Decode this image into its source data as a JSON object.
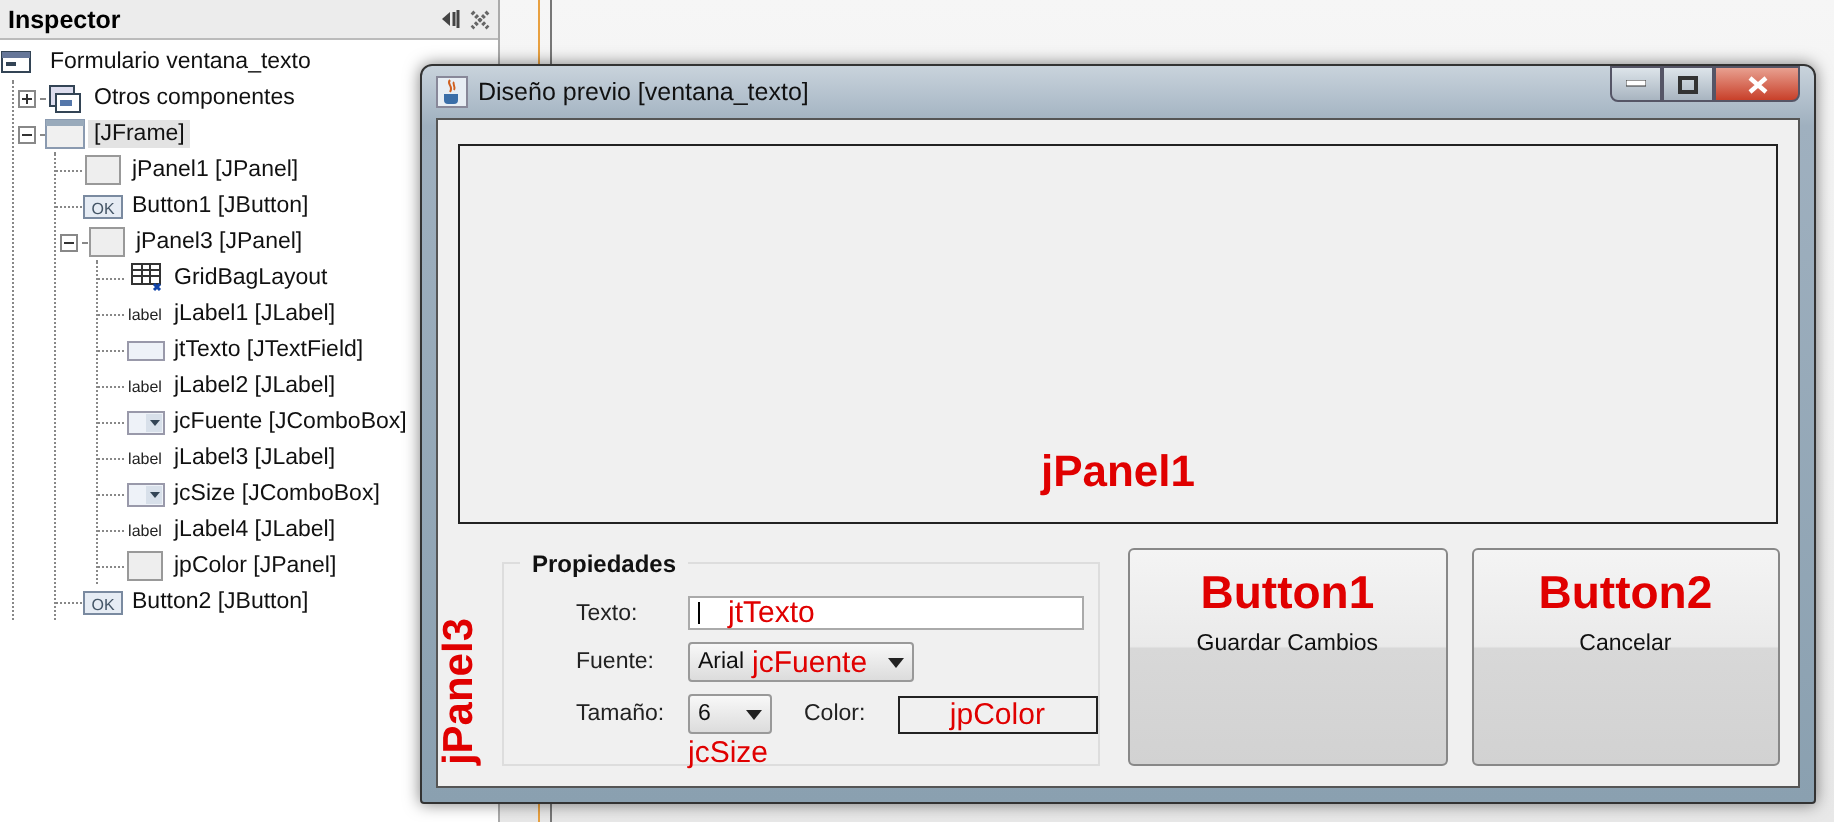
{
  "inspector": {
    "title": "Inspector",
    "tree": [
      {
        "label": "Formulario ventana_texto",
        "kind": "form",
        "selected": false,
        "children": [
          {
            "label": "Otros componentes",
            "kind": "components",
            "selected": false,
            "expanded": false
          },
          {
            "label": "[JFrame]",
            "kind": "frame",
            "selected": true,
            "expanded": true,
            "children": [
              {
                "label": "jPanel1 [JPanel]",
                "kind": "panel",
                "selected": false
              },
              {
                "label": "Button1 [JButton]",
                "kind": "button",
                "icon_text": "OK",
                "selected": false
              },
              {
                "label": "jPanel3 [JPanel]",
                "kind": "panel",
                "selected": false,
                "expanded": true,
                "children": [
                  {
                    "label": "GridBagLayout",
                    "kind": "layout",
                    "selected": false
                  },
                  {
                    "label": "jLabel1 [JLabel]",
                    "kind": "label",
                    "icon_text": "label",
                    "selected": false
                  },
                  {
                    "label": "jtTexto [JTextField]",
                    "kind": "textfield",
                    "selected": false
                  },
                  {
                    "label": "jLabel2 [JLabel]",
                    "kind": "label",
                    "icon_text": "label",
                    "selected": false
                  },
                  {
                    "label": "jcFuente [JComboBox]",
                    "kind": "combo",
                    "selected": false
                  },
                  {
                    "label": "jLabel3 [JLabel]",
                    "kind": "label",
                    "icon_text": "label",
                    "selected": false
                  },
                  {
                    "label": "jcSize [JComboBox]",
                    "kind": "combo",
                    "selected": false
                  },
                  {
                    "label": "jLabel4 [JLabel]",
                    "kind": "label",
                    "icon_text": "label",
                    "selected": false
                  },
                  {
                    "label": "jpColor [JPanel]",
                    "kind": "panel",
                    "selected": false
                  }
                ]
              },
              {
                "label": "Button2 [JButton]",
                "kind": "button",
                "icon_text": "OK",
                "selected": false
              }
            ]
          }
        ]
      }
    ]
  },
  "preview_window": {
    "title": "Diseño previo [ventana_texto]",
    "panel1": {
      "annotation": "jPanel1"
    },
    "properties": {
      "annotation": "jPanel3",
      "title": "Propiedades",
      "text_label": "Texto:",
      "text_field": {
        "annotation": "jtTexto"
      },
      "font_label": "Fuente:",
      "font_combo": {
        "value": "Arial",
        "annotation": "jcFuente"
      },
      "size_label": "Tamaño:",
      "size_combo": {
        "value": "6",
        "annotation": "jcSize"
      },
      "color_label": "Color:",
      "color_panel": {
        "annotation": "jpColor"
      }
    },
    "buttons": [
      {
        "annotation": "Button1",
        "label": "Guardar Cambios"
      },
      {
        "annotation": "Button2",
        "label": "Cancelar"
      }
    ]
  }
}
